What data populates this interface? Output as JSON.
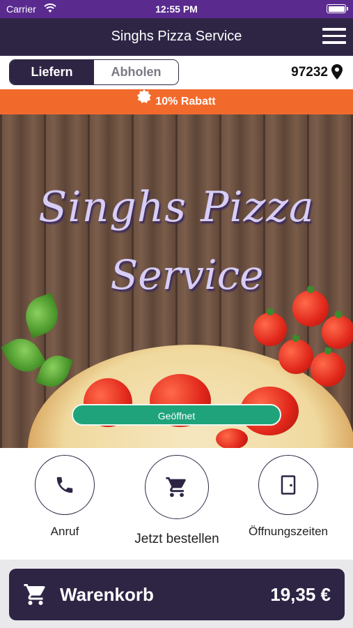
{
  "status_bar": {
    "carrier": "Carrier",
    "time": "12:55 PM"
  },
  "nav": {
    "title": "Singhs Pizza Service"
  },
  "mode": {
    "delivery_label": "Liefern",
    "pickup_label": "Abholen",
    "selected": "Liefern",
    "zip": "97232"
  },
  "discount": {
    "label": "10% Rabatt"
  },
  "hero": {
    "logo_line1": "Singhs Pizza",
    "logo_line2": "Service",
    "status_badge": "Geöffnet"
  },
  "actions": [
    {
      "label": "Anruf",
      "icon": "phone-icon"
    },
    {
      "label": "Jetzt bestellen",
      "icon": "cart-icon"
    },
    {
      "label": "Öffnungszeiten",
      "icon": "door-icon"
    }
  ],
  "cart": {
    "label": "Warenkorb",
    "total": "19,35 €"
  },
  "colors": {
    "status_bar": "#5a2a8f",
    "primary": "#2e2545",
    "discount": "#f26a2b",
    "open_badge": "#1ea37a"
  }
}
